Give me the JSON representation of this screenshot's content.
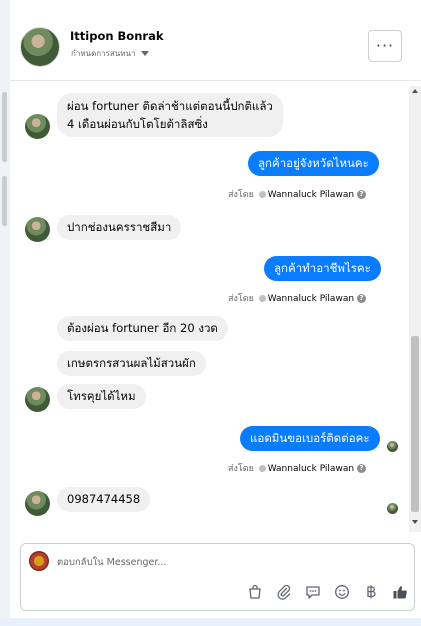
{
  "header": {
    "name": "Ittipon Bonrak",
    "subtitle": "กำหนดการสนทนา",
    "more_label": "···"
  },
  "messages": [
    {
      "id": "m1",
      "direction": "in",
      "lines": [
        "ผ่อน fortuner ติดล่าช้าแต่ตอนนี้ปกติแล้ว",
        "4 เดือนผ่อนกับโตโยต้าลิสซิ่ง"
      ]
    },
    {
      "id": "m2",
      "direction": "out",
      "text": "ลูกค้าอยู่จังหวัดไหนคะ"
    },
    {
      "id": "m3",
      "direction": "in",
      "text": "ปากช่องนครราชสีมา"
    },
    {
      "id": "m4",
      "direction": "out",
      "text": "ลูกค้าทำอาชีพไรคะ"
    },
    {
      "id": "m5",
      "direction": "in",
      "text": "ต้องผ่อน fortuner อีก 20 งวด"
    },
    {
      "id": "m6",
      "direction": "in",
      "text": "เกษตรกรสวนผลไม้สวนผัก"
    },
    {
      "id": "m7",
      "direction": "in",
      "text": "โทรคุยได้ไหม"
    },
    {
      "id": "m8",
      "direction": "out",
      "text": "แอดมินขอเบอร์ติดต่อคะ"
    },
    {
      "id": "m9",
      "direction": "in",
      "text": "0987474458"
    }
  ],
  "sent_by": {
    "prefix": "ส่งโดย",
    "name": "Wannaluck Pilawan",
    "help": "?"
  },
  "composer": {
    "placeholder": "ตอบกลับใน Messenger...",
    "tools": [
      "bag-icon",
      "attachment-icon",
      "quick-reply-icon",
      "emoji-icon",
      "baht-icon",
      "like-icon"
    ]
  },
  "colors": {
    "outgoing_bubble": "#0a7cff",
    "incoming_bubble": "#f0f0f0",
    "accent": "#0a7cff"
  }
}
